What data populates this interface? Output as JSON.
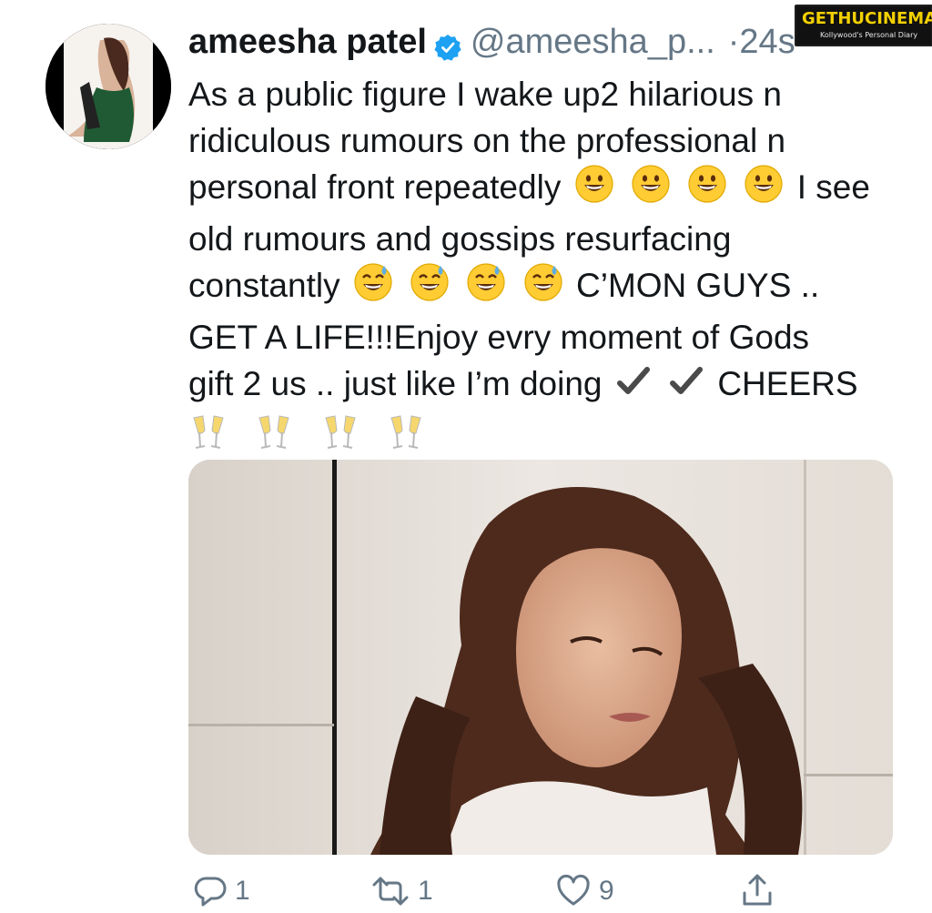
{
  "tweet": {
    "author_name": "ameesha patel",
    "handle": "@ameesha_p...",
    "separator": "·",
    "time": "24s",
    "text_lines": [
      "As a public figure I wake up2 hilarious n",
      "ridiculous rumours on the professional n",
      "personal front repeatedly",
      "I see",
      "old rumours and gossips resurfacing",
      "constantly",
      "C’MON GUYS ..",
      "GET A LIFE!!!Enjoy evry moment of Gods",
      "gift 2 us .. just like I’m doing",
      "CHEERS"
    ],
    "emoji": {
      "grin": "grinning-face-emoji",
      "sweat": "grinning-sweat-emoji",
      "check": "check-mark-emoji",
      "cheers": "clinking-glasses-emoji"
    }
  },
  "actions": {
    "reply_count": "1",
    "retweet_count": "1",
    "like_count": "9"
  },
  "watermark": {
    "main": "GETHUCINEMA",
    "sub": "Kollywood's Personal Diary"
  },
  "colors": {
    "text": "#14171a",
    "secondary": "#657786",
    "verified": "#1da1f2",
    "watermark_yellow": "#f2d000"
  }
}
